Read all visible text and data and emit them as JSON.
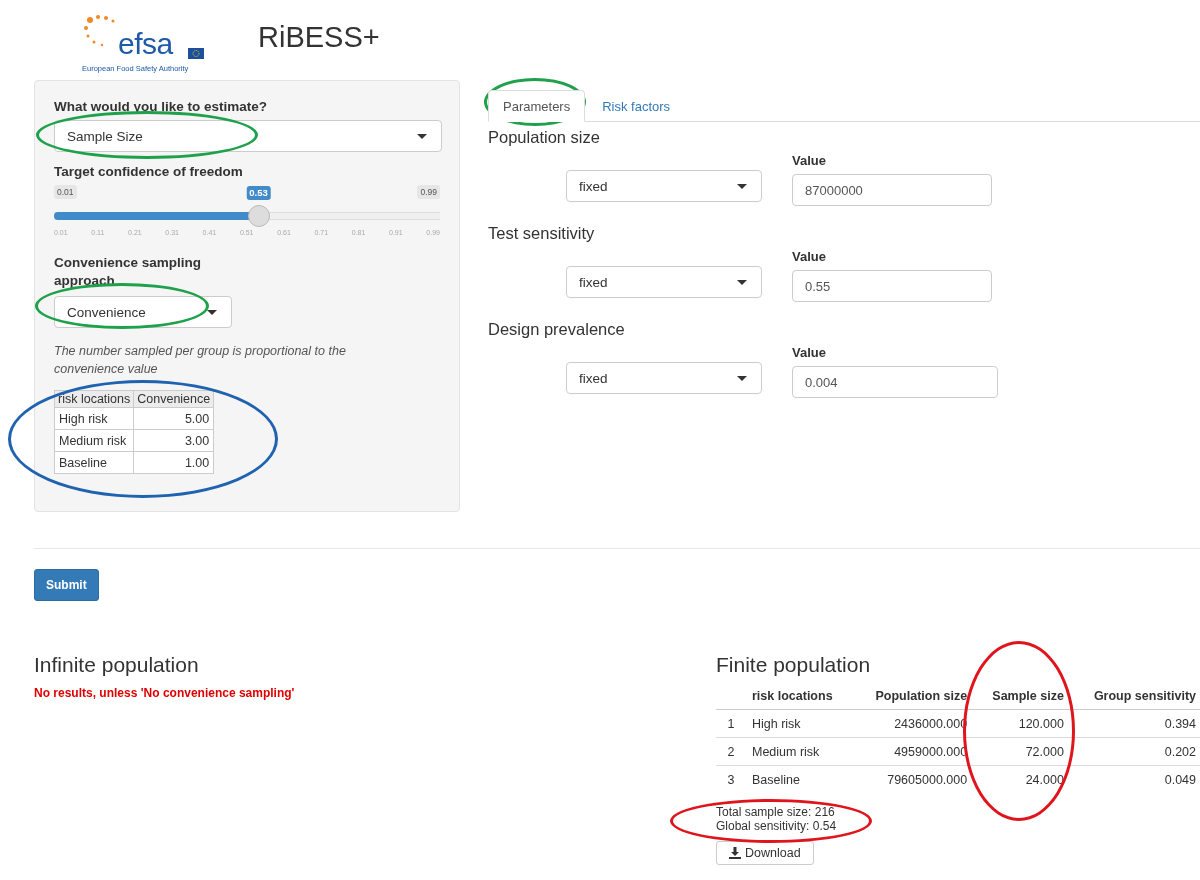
{
  "header": {
    "logo": {
      "name": "efsa",
      "subtitle": "European Food Safety Authority"
    },
    "title": "RiBESS+"
  },
  "sidebar": {
    "estimate": {
      "label": "What would you like to estimate?",
      "value": "Sample Size",
      "color": "#1fa04a"
    },
    "slider": {
      "label": "Target confidence of freedom",
      "min": "0.01",
      "max": "0.99",
      "value": "0.53",
      "level": 0.53,
      "ticks": [
        "0.01",
        "0.11",
        "0.21",
        "0.31",
        "0.41",
        "0.51",
        "0.61",
        "0.71",
        "0.81",
        "0.91",
        "0.99"
      ]
    },
    "convenience": {
      "label": "Convenience sampling approach",
      "value": "Convenience",
      "color": "#1fa04a"
    },
    "help": "The number sampled per group is proportional to the convenience value",
    "table": {
      "color": "#1f63b0",
      "columns": [
        "risk locations",
        "Convenience"
      ],
      "rows": [
        [
          "High risk",
          "5.00"
        ],
        [
          "Medium risk",
          "3.00"
        ],
        [
          "Baseline",
          "1.00"
        ]
      ]
    }
  },
  "tabs": [
    {
      "label": "Parameters",
      "selected": true,
      "color": "#1fa04a"
    },
    {
      "label": "Risk factors",
      "selected": false
    }
  ],
  "parameters": [
    {
      "label": "Population size",
      "distribution": "fixed",
      "value_label": "Value",
      "value": "87000000"
    },
    {
      "label": "Test sensitivity",
      "distribution": "fixed",
      "value_label": "Value",
      "value": "0.55"
    },
    {
      "label": "Design prevalence",
      "distribution": "fixed",
      "value_label": "Value",
      "value": "0.004"
    }
  ],
  "submit": "Submit",
  "infinite": {
    "title": "Infinite population",
    "message": "No results, unless 'No convenience sampling'"
  },
  "finite": {
    "title": "Finite population",
    "columns": [
      {
        "label": "risk locations"
      },
      {
        "label": "Population size"
      },
      {
        "label": "Sample size",
        "color": "#e0141c"
      },
      {
        "label": "Group sensitivity"
      }
    ],
    "rows": [
      {
        "index": "1",
        "cells": [
          "High risk",
          "2436000.000",
          "120.000",
          "0.394"
        ]
      },
      {
        "index": "2",
        "cells": [
          "Medium risk",
          "4959000.000",
          "72.000",
          "0.202"
        ]
      },
      {
        "index": "3",
        "cells": [
          "Baseline",
          "79605000.000",
          "24.000",
          "0.049"
        ]
      }
    ],
    "summary": {
      "lines": [
        "Total sample size: 216",
        "Global sensitivity: 0.54"
      ],
      "color": "#e0141c"
    },
    "download": "Download"
  }
}
